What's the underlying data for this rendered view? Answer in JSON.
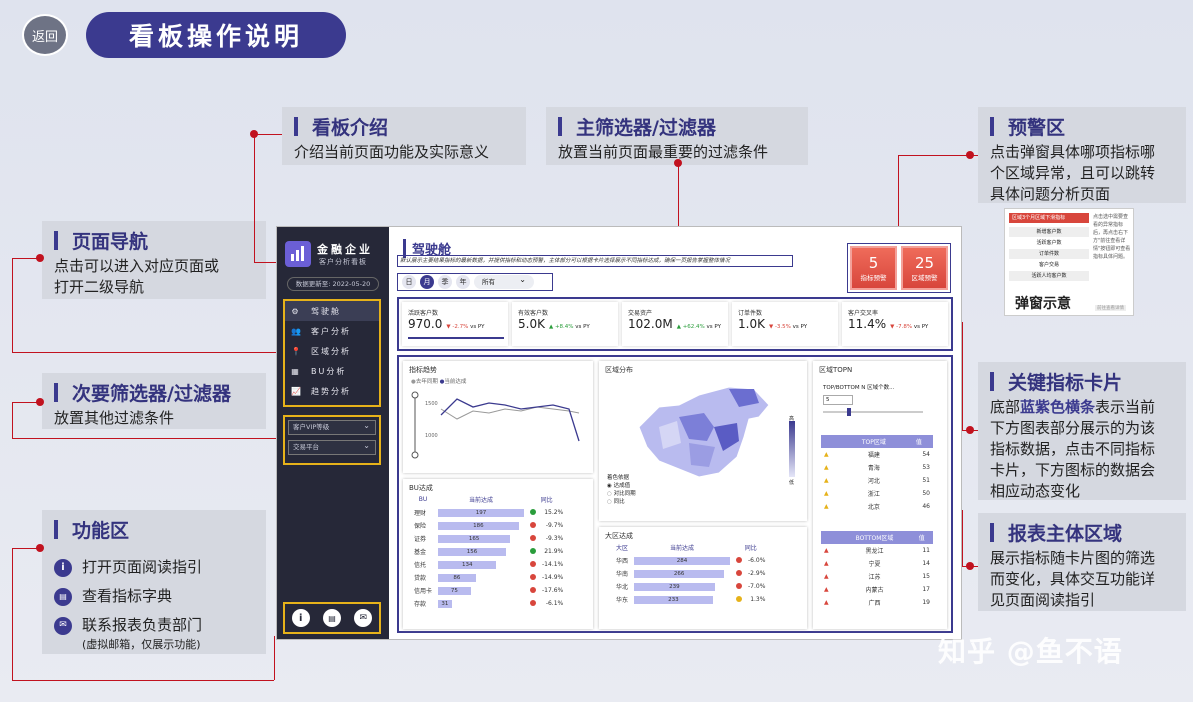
{
  "header": {
    "back_label": "返回",
    "title": "看板操作说明"
  },
  "annotations": {
    "intro": {
      "title": "看板介绍",
      "desc": "介绍当前页面功能及实际意义"
    },
    "main_filter": {
      "title": "主筛选器/过滤器",
      "desc": "放置当前页面最重要的过滤条件"
    },
    "warning": {
      "title": "预警区",
      "desc1": "点击弹窗具体哪项指标哪",
      "desc2": "个区域异常，且可以跳转",
      "desc3": "具体问题分析页面"
    },
    "nav": {
      "title": "页面导航",
      "desc1": "点击可以进入对应页面或",
      "desc2": "打开二级导航"
    },
    "secondary_filter": {
      "title": "次要筛选器/过滤器",
      "desc": "放置其他过滤条件"
    },
    "kpi": {
      "title": "关键指标卡片",
      "desc_a": "底部",
      "desc_b": "蓝紫色横条",
      "desc_c": "表示当前",
      "desc2": "下方图表部分展示的为该",
      "desc3": "指标数据，点击不同指标",
      "desc4": "卡片，下方图标的数据会",
      "desc5": "相应动态变化"
    },
    "function": {
      "title": "功能区",
      "items": [
        "打开页面阅读指引",
        "查看指标字典",
        "联系报表负责部门"
      ],
      "note": "(虚拟邮箱，仅展示功能)"
    },
    "report": {
      "title": "报表主体区域",
      "desc1": "展示指标随卡片图的筛选",
      "desc2": "而变化，具体交互功能详",
      "desc3": "见页面阅读指引"
    }
  },
  "popup": {
    "label": "弹窗示意",
    "header": "区域3个月区域下滑指标",
    "items": [
      "新增客户数",
      "活跃客户数",
      "订单件数",
      "客户交易",
      "活跃人均客户数"
    ],
    "tip": "点击选中需要查看的异常指标后，再点击右下方\"前往查看详情\"按钮即可查看指标具体问题。",
    "btn": "前往查看详情"
  },
  "dashboard": {
    "side": {
      "title": "金融企业",
      "subtitle": "客户分析看板",
      "date": "数据更新至: 2022-05-20",
      "nav": [
        {
          "icon": "⚙",
          "label": "驾驶舱"
        },
        {
          "icon": "👥",
          "label": "客户分析"
        },
        {
          "icon": "📍",
          "label": "区域分析"
        },
        {
          "icon": "▦",
          "label": "BU分析"
        },
        {
          "icon": "📈",
          "label": "趋势分析"
        }
      ],
      "filters": [
        "客户VIP等级",
        "交易平台"
      ]
    },
    "title": "驾驶舱",
    "intro": "默认展示主要结果指标的最新数据，并提供指标和动态预警，主体部分可以根据卡片选择展示不同指标达成，确保一页报告掌握整体情况",
    "tabs": [
      "日",
      "月",
      "季",
      "年"
    ],
    "tab_select": "所有",
    "warnings": [
      {
        "num": "5",
        "label": "指标预警"
      },
      {
        "num": "25",
        "label": "区域预警"
      }
    ],
    "kpis": [
      {
        "label": "活跃客户数",
        "value": "970.0",
        "change": "-2.7%",
        "dir": "down",
        "vs": "vs PY"
      },
      {
        "label": "有效客户数",
        "value": "5.0K",
        "change": "+8.4%",
        "dir": "up",
        "vs": "vs PY"
      },
      {
        "label": "交易资产",
        "value": "102.0M",
        "change": "+62.4%",
        "dir": "up",
        "vs": "vs PY"
      },
      {
        "label": "订单件数",
        "value": "1.0K",
        "change": "-3.5%",
        "dir": "down",
        "vs": "vs PY"
      },
      {
        "label": "客户交叉率",
        "value": "11.4%",
        "change": "-7.8%",
        "dir": "down",
        "vs": "vs PY"
      }
    ],
    "trend": {
      "title": "指标趋势",
      "legend": [
        "去年同期",
        "当前达成"
      ],
      "ylabels": [
        "1500",
        "1000"
      ]
    },
    "map": {
      "title": "区域分布",
      "legend_title": "着色依据",
      "options": [
        "达成值",
        "对比同期",
        "同比"
      ],
      "scale_hi": "高",
      "scale_lo": "低"
    },
    "topn": {
      "title": "区域TOPN",
      "control_label": "TOP/BOTTOM N 区域个数...",
      "n": "5",
      "top_header": "TOP区域",
      "top_val": "值",
      "top_rows": [
        {
          "name": "福建",
          "v": "54"
        },
        {
          "name": "青海",
          "v": "53"
        },
        {
          "name": "河北",
          "v": "51"
        },
        {
          "name": "浙江",
          "v": "50"
        },
        {
          "name": "北京",
          "v": "46"
        }
      ],
      "bottom_header": "BOTTOM区域",
      "bottom_val": "值",
      "bottom_rows": [
        {
          "name": "黑龙江",
          "v": "11"
        },
        {
          "name": "宁夏",
          "v": "14"
        },
        {
          "name": "江苏",
          "v": "15"
        },
        {
          "name": "内蒙古",
          "v": "17"
        },
        {
          "name": "广西",
          "v": "19"
        }
      ]
    },
    "bu": {
      "title": "BU达成",
      "cols": [
        "BU",
        "当前达成",
        "同比"
      ],
      "rows": [
        {
          "name": "理财",
          "v": "197",
          "pct": 1.0,
          "c": "#2a9d3b",
          "yoy": "15.2%"
        },
        {
          "name": "保险",
          "v": "186",
          "pct": 0.94,
          "c": "#d8463c",
          "yoy": "-9.7%"
        },
        {
          "name": "证券",
          "v": "165",
          "pct": 0.84,
          "c": "#d8463c",
          "yoy": "-9.3%"
        },
        {
          "name": "基金",
          "v": "156",
          "pct": 0.79,
          "c": "#2a9d3b",
          "yoy": "21.9%"
        },
        {
          "name": "信托",
          "v": "134",
          "pct": 0.68,
          "c": "#d8463c",
          "yoy": "-14.1%"
        },
        {
          "name": "贷款",
          "v": "86",
          "pct": 0.44,
          "c": "#d8463c",
          "yoy": "-14.9%"
        },
        {
          "name": "信用卡",
          "v": "75",
          "pct": 0.38,
          "c": "#d8463c",
          "yoy": "-17.6%"
        },
        {
          "name": "存款",
          "v": "31",
          "pct": 0.16,
          "c": "#d8463c",
          "yoy": "-6.1%"
        }
      ]
    },
    "region": {
      "title": "大区达成",
      "cols": [
        "大区",
        "当前达成",
        "同比"
      ],
      "rows": [
        {
          "name": "华西",
          "v": "284",
          "pct": 1.0,
          "c": "#d8463c",
          "yoy": "-6.0%"
        },
        {
          "name": "华南",
          "v": "266",
          "pct": 0.94,
          "c": "#d8463c",
          "yoy": "-2.9%"
        },
        {
          "name": "华北",
          "v": "239",
          "pct": 0.84,
          "c": "#d8463c",
          "yoy": "-7.0%"
        },
        {
          "name": "华东",
          "v": "233",
          "pct": 0.82,
          "c": "#e6b21a",
          "yoy": "1.3%"
        }
      ]
    }
  },
  "watermark": "知乎 @鱼不语",
  "colors": {
    "accent": "#3b3a8f",
    "line": "#c1121f",
    "highlight": "#e6b21a"
  }
}
